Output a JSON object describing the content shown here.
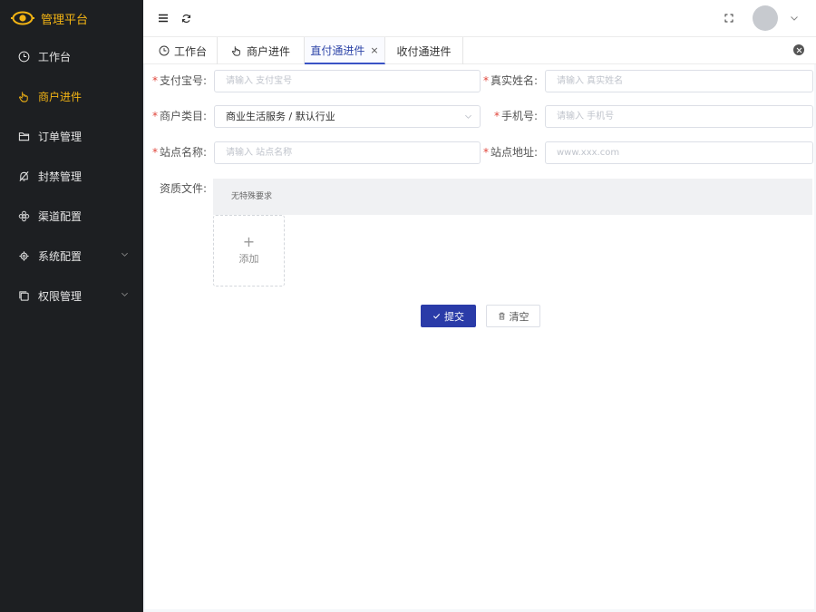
{
  "app": {
    "title": "管理平台"
  },
  "sidebar": {
    "items": [
      {
        "label": "工作台",
        "icon": "clock-icon"
      },
      {
        "label": "商户进件",
        "icon": "hand-pointer-icon"
      },
      {
        "label": "订单管理",
        "icon": "folder-icon"
      },
      {
        "label": "封禁管理",
        "icon": "bell-off-icon"
      },
      {
        "label": "渠道配置",
        "icon": "flower-icon"
      },
      {
        "label": "系统配置",
        "icon": "gear-icon"
      },
      {
        "label": "权限管理",
        "icon": "copy-icon"
      }
    ]
  },
  "tabs": [
    {
      "label": "工作台",
      "icon": "clock-icon"
    },
    {
      "label": "商户进件",
      "icon": "hand-pointer-icon"
    },
    {
      "label": "直付通进件",
      "close": "×"
    },
    {
      "label": "收付通进件"
    }
  ],
  "form": {
    "alipay": {
      "label": "支付宝号:",
      "placeholder": "请输入 支付宝号"
    },
    "realname": {
      "label": "真实姓名:",
      "placeholder": "请输入 真实姓名"
    },
    "category": {
      "label": "商户类目:",
      "value": "商业生活服务 / 默认行业"
    },
    "phone": {
      "label": "手机号:",
      "placeholder": "请输入 手机号"
    },
    "site_name": {
      "label": "站点名称:",
      "placeholder": "请输入 站点名称"
    },
    "site_url": {
      "label": "站点地址:",
      "placeholder": "www.xxx.com"
    },
    "files": {
      "label": "资质文件:",
      "note": "无特殊要求",
      "add": "添加",
      "plus": "+"
    }
  },
  "buttons": {
    "submit": "提交",
    "clear": "清空"
  },
  "colors": {
    "accent": "#2a3ba8",
    "brand": "#f3b414",
    "sidebar": "#1d1f22",
    "required": "#e0453a"
  }
}
